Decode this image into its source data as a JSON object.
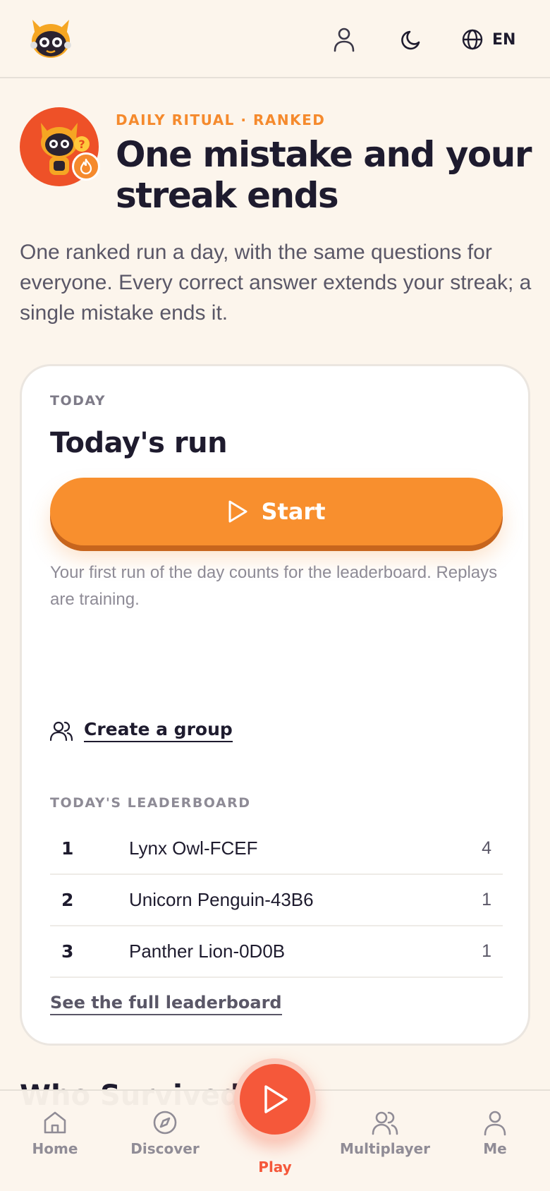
{
  "header": {
    "logo_icon": "cat-robot-mascot-logo",
    "user_icon": "user-icon",
    "theme_icon": "moon-icon",
    "language_icon": "globe-icon",
    "language_label": "EN"
  },
  "hero": {
    "avatar_icon": "cat-robot-mascot-avatar",
    "badge_icon": "flame-icon",
    "eyebrow": "DAILY RITUAL · RANKED",
    "title": "One mistake and your streak ends",
    "description": "One ranked run a day, with the same questions for everyone. Every correct answer extends your streak; a single mistake ends it."
  },
  "card": {
    "eyebrow": "TODAY",
    "title": "Today's run",
    "start_label": "Start",
    "start_icon": "play-icon",
    "note": "Your first run of the day counts for the leaderboard. Replays are training.",
    "create_group_icon": "users-icon",
    "create_group_label": "Create a group",
    "leaderboard_title": "TODAY'S LEADERBOARD",
    "leaderboard": [
      {
        "rank": "1",
        "name": "Lynx Owl-FCEF",
        "score": "4"
      },
      {
        "rank": "2",
        "name": "Unicorn Penguin-43B6",
        "score": "1"
      },
      {
        "rank": "3",
        "name": "Panther Lion-0D0B",
        "score": "1"
      }
    ],
    "see_full_label": "See the full leaderboard"
  },
  "next_section_peek": "Who Survived",
  "bottom_nav": {
    "items": [
      {
        "label": "Home",
        "icon": "home-icon"
      },
      {
        "label": "Discover",
        "icon": "compass-icon"
      },
      {
        "label": "Play",
        "icon": "play-icon"
      },
      {
        "label": "Multiplayer",
        "icon": "users-icon"
      },
      {
        "label": "Me",
        "icon": "user-icon"
      }
    ],
    "active": "Play"
  },
  "colors": {
    "background": "#fcf5ec",
    "accent_orange": "#f88f2e",
    "accent_red": "#f5583a",
    "text_dark": "#1e1b2e",
    "text_muted": "#8e8b96"
  }
}
